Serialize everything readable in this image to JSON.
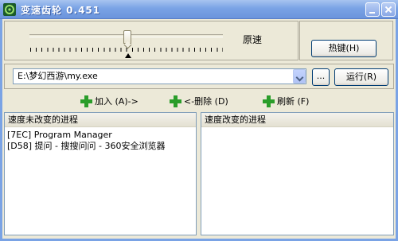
{
  "window": {
    "title": "变速齿轮 0.451"
  },
  "slider": {
    "label": "原速"
  },
  "buttons": {
    "hotkey": "热键(H)",
    "browse": "...",
    "run": "运行(R)"
  },
  "path": {
    "value": "E:\\梦幻西游\\my.exe"
  },
  "actions": {
    "add": "加入 (A)->",
    "remove": "<-删除 (D)",
    "refresh": "刷新 (F)"
  },
  "lists": {
    "unchanged_header": "速度未改变的进程",
    "changed_header": "速度改变的进程",
    "unchanged_items": [
      "[7EC]  Program Manager",
      "[D58]  提问 - 搜搜问问 - 360安全浏览器"
    ],
    "changed_items": []
  },
  "colors": {
    "titlebar": "#7aa3e5",
    "window_bg": "#ece9d8",
    "plus_icon": "#2a9d2a"
  }
}
